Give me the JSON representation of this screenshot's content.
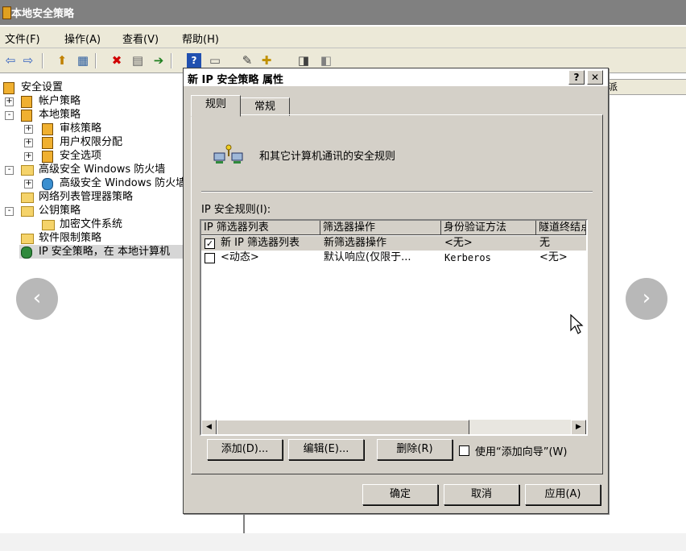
{
  "main": {
    "title": "本地安全策略",
    "menu": [
      "文件(F)",
      "操作(A)",
      "查看(V)",
      "帮助(H)"
    ],
    "toolbar_icons": [
      "back-icon",
      "forward-icon",
      "up-folder-icon",
      "show-hide-tree-icon",
      "delete-icon",
      "properties-icon",
      "export-icon",
      "help-icon",
      "console-icon",
      "manage-filters-icon",
      "add-policy-icon",
      "assign-icon",
      "unassign-icon"
    ]
  },
  "tree": [
    {
      "label": "安全设置",
      "level": 0,
      "expander": "",
      "icon": "policy-icon"
    },
    {
      "label": "帐户策略",
      "level": 1,
      "expander": "+",
      "icon": "policy-folder-icon"
    },
    {
      "label": "本地策略",
      "level": 1,
      "expander": "-",
      "icon": "policy-folder-icon"
    },
    {
      "label": "审核策略",
      "level": 2,
      "expander": "+",
      "icon": "policy-folder-icon"
    },
    {
      "label": "用户权限分配",
      "level": 2,
      "expander": "+",
      "icon": "policy-folder-icon"
    },
    {
      "label": "安全选项",
      "level": 2,
      "expander": "+",
      "icon": "policy-folder-icon"
    },
    {
      "label": "高级安全 Windows 防火墙",
      "level": 1,
      "expander": "-",
      "icon": "folder-icon"
    },
    {
      "label": "高级安全 Windows 防火墙",
      "level": 2,
      "expander": "+",
      "icon": "firewall-icon"
    },
    {
      "label": "网络列表管理器策略",
      "level": 1,
      "expander": "",
      "icon": "folder-icon"
    },
    {
      "label": "公钥策略",
      "level": 1,
      "expander": "-",
      "icon": "folder-icon"
    },
    {
      "label": "加密文件系统",
      "level": 2,
      "expander": "",
      "icon": "folder-icon"
    },
    {
      "label": "软件限制策略",
      "level": 1,
      "expander": "",
      "icon": "folder-icon"
    },
    {
      "label": "IP 安全策略，在 本地计算机",
      "level": 1,
      "expander": "",
      "icon": "ipsec-icon"
    }
  ],
  "right_header_fragment": "派",
  "dialog": {
    "title": "新 IP 安全策略 属性",
    "help_btn": "?",
    "close_btn": "✕",
    "tabs": [
      "规则",
      "常规"
    ],
    "description": "和其它计算机通讯的安全规则",
    "rules_label": "IP 安全规则(I):",
    "columns": [
      "IP 筛选器列表",
      "筛选器操作",
      "身份验证方法",
      "隧道终结点"
    ],
    "rows": [
      {
        "checked": true,
        "check_mark": "✓",
        "cells": [
          "新 IP 筛选器列表",
          "新筛选器操作",
          "<无>",
          "无"
        ]
      },
      {
        "checked": false,
        "check_mark": "",
        "cells": [
          "<动态>",
          "默认响应(仅限于...",
          "Kerberos",
          "<无>"
        ]
      }
    ],
    "buttons": {
      "add": "添加(D)...",
      "edit": "编辑(E)...",
      "remove": "删除(R)",
      "wizard": "使用“添加向导”(W)"
    },
    "footer": {
      "ok": "确定",
      "cancel": "取消",
      "apply": "应用(A)"
    }
  },
  "nav": {
    "prev": "‹",
    "next": "›"
  }
}
